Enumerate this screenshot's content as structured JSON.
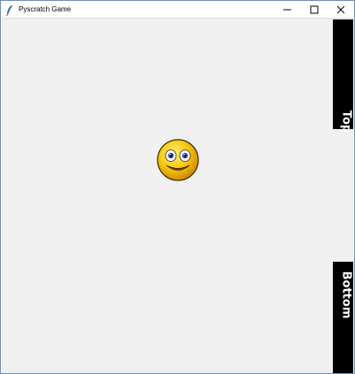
{
  "window": {
    "title": "Pyscratch Game",
    "icon": "feather-icon",
    "controls": [
      "minimize-icon",
      "maximize-icon",
      "close-icon"
    ]
  },
  "stage": {
    "background": "#f0f0f0",
    "sprites": [
      {
        "name": "smiley-face",
        "icon": "smiley-face-icon"
      }
    ],
    "bars": [
      {
        "label": "Top",
        "color": "#000000"
      },
      {
        "label": "Bottom",
        "color": "#000000"
      }
    ]
  }
}
